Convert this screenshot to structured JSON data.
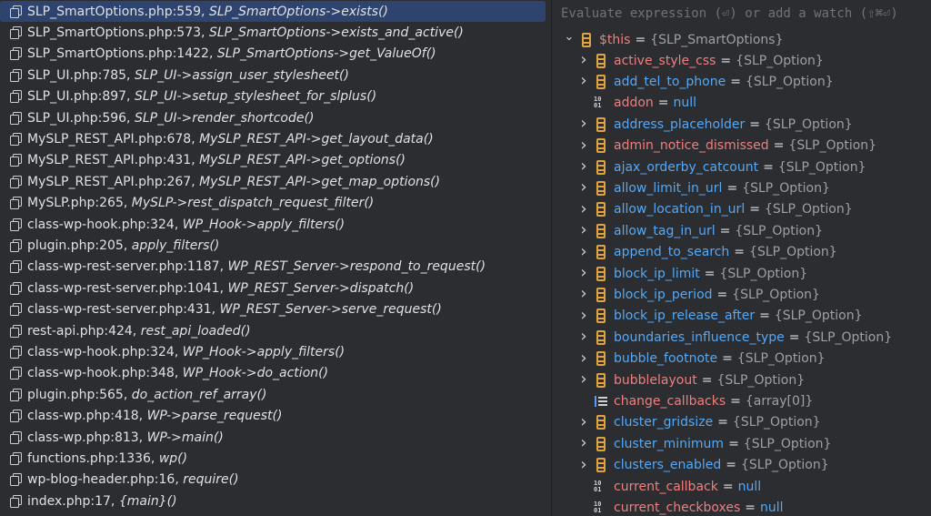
{
  "frames": [
    {
      "file": "SLP_SmartOptions.php:559,",
      "fn": "SLP_SmartOptions->exists()",
      "selected": true
    },
    {
      "file": "SLP_SmartOptions.php:573,",
      "fn": "SLP_SmartOptions->exists_and_active()"
    },
    {
      "file": "SLP_SmartOptions.php:1422,",
      "fn": "SLP_SmartOptions->get_ValueOf()"
    },
    {
      "file": "SLP_UI.php:785,",
      "fn": "SLP_UI->assign_user_stylesheet()"
    },
    {
      "file": "SLP_UI.php:897,",
      "fn": "SLP_UI->setup_stylesheet_for_slplus()"
    },
    {
      "file": "SLP_UI.php:596,",
      "fn": "SLP_UI->render_shortcode()"
    },
    {
      "file": "MySLP_REST_API.php:678,",
      "fn": "MySLP_REST_API->get_layout_data()"
    },
    {
      "file": "MySLP_REST_API.php:431,",
      "fn": "MySLP_REST_API->get_options()"
    },
    {
      "file": "MySLP_REST_API.php:267,",
      "fn": "MySLP_REST_API->get_map_options()"
    },
    {
      "file": "MySLP.php:265,",
      "fn": "MySLP->rest_dispatch_request_filter()"
    },
    {
      "file": "class-wp-hook.php:324,",
      "fn": "WP_Hook->apply_filters()"
    },
    {
      "file": "plugin.php:205,",
      "fn": "apply_filters()"
    },
    {
      "file": "class-wp-rest-server.php:1187,",
      "fn": "WP_REST_Server->respond_to_request()"
    },
    {
      "file": "class-wp-rest-server.php:1041,",
      "fn": "WP_REST_Server->dispatch()"
    },
    {
      "file": "class-wp-rest-server.php:431,",
      "fn": "WP_REST_Server->serve_request()"
    },
    {
      "file": "rest-api.php:424,",
      "fn": "rest_api_loaded()"
    },
    {
      "file": "class-wp-hook.php:324,",
      "fn": "WP_Hook->apply_filters()"
    },
    {
      "file": "class-wp-hook.php:348,",
      "fn": "WP_Hook->do_action()"
    },
    {
      "file": "plugin.php:565,",
      "fn": "do_action_ref_array()"
    },
    {
      "file": "class-wp.php:418,",
      "fn": "WP->parse_request()"
    },
    {
      "file": "class-wp.php:813,",
      "fn": "WP->main()"
    },
    {
      "file": "functions.php:1336,",
      "fn": "wp()"
    },
    {
      "file": "wp-blog-header.php:16,",
      "fn": "require()"
    },
    {
      "file": "index.php:17,",
      "fn": "{main}()"
    }
  ],
  "expression_bar": {
    "placeholder": "Evaluate expression (⏎) or add a watch (⇧⌘⏎)"
  },
  "variables": {
    "root": {
      "name": "$this",
      "value": "{SLP_SmartOptions}",
      "expanded": true,
      "icon": "object-icon"
    },
    "children": [
      {
        "name": "active_style_css",
        "value": "{SLP_Option}",
        "icon": "object-icon",
        "expandable": true,
        "color": "red"
      },
      {
        "name": "add_tel_to_phone",
        "value": "{SLP_Option}",
        "icon": "object-icon",
        "expandable": true,
        "color": "blue"
      },
      {
        "name": "addon",
        "value": "null",
        "icon": "primitive-icon",
        "expandable": false,
        "color": "red"
      },
      {
        "name": "address_placeholder",
        "value": "{SLP_Option}",
        "icon": "object-icon",
        "expandable": true,
        "color": "blue"
      },
      {
        "name": "admin_notice_dismissed",
        "value": "{SLP_Option}",
        "icon": "object-icon",
        "expandable": true,
        "color": "red"
      },
      {
        "name": "ajax_orderby_catcount",
        "value": "{SLP_Option}",
        "icon": "object-icon",
        "expandable": true,
        "color": "blue"
      },
      {
        "name": "allow_limit_in_url",
        "value": "{SLP_Option}",
        "icon": "object-icon",
        "expandable": true,
        "color": "blue"
      },
      {
        "name": "allow_location_in_url",
        "value": "{SLP_Option}",
        "icon": "object-icon",
        "expandable": true,
        "color": "blue"
      },
      {
        "name": "allow_tag_in_url",
        "value": "{SLP_Option}",
        "icon": "object-icon",
        "expandable": true,
        "color": "blue"
      },
      {
        "name": "append_to_search",
        "value": "{SLP_Option}",
        "icon": "object-icon",
        "expandable": true,
        "color": "blue"
      },
      {
        "name": "block_ip_limit",
        "value": "{SLP_Option}",
        "icon": "object-icon",
        "expandable": true,
        "color": "blue"
      },
      {
        "name": "block_ip_period",
        "value": "{SLP_Option}",
        "icon": "object-icon",
        "expandable": true,
        "color": "blue"
      },
      {
        "name": "block_ip_release_after",
        "value": "{SLP_Option}",
        "icon": "object-icon",
        "expandable": true,
        "color": "blue"
      },
      {
        "name": "boundaries_influence_type",
        "value": "{SLP_Option}",
        "icon": "object-icon",
        "expandable": true,
        "color": "blue"
      },
      {
        "name": "bubble_footnote",
        "value": "{SLP_Option}",
        "icon": "object-icon",
        "expandable": true,
        "color": "blue"
      },
      {
        "name": "bubblelayout",
        "value": "{SLP_Option}",
        "icon": "object-icon",
        "expandable": true,
        "color": "red"
      },
      {
        "name": "change_callbacks",
        "value": "{array[0]}",
        "icon": "array-icon",
        "expandable": false,
        "color": "red"
      },
      {
        "name": "cluster_gridsize",
        "value": "{SLP_Option}",
        "icon": "object-icon",
        "expandable": true,
        "color": "blue"
      },
      {
        "name": "cluster_minimum",
        "value": "{SLP_Option}",
        "icon": "object-icon",
        "expandable": true,
        "color": "blue"
      },
      {
        "name": "clusters_enabled",
        "value": "{SLP_Option}",
        "icon": "object-icon",
        "expandable": true,
        "color": "blue"
      },
      {
        "name": "current_callback",
        "value": "null",
        "icon": "primitive-icon",
        "expandable": false,
        "color": "red"
      },
      {
        "name": "current_checkboxes",
        "value": "null",
        "icon": "primitive-icon",
        "expandable": false,
        "color": "red"
      }
    ]
  },
  "colors": {
    "background": "#2b2d30",
    "selection": "#2e436e",
    "name_red": "#ef7f7f",
    "name_blue": "#56a8f5",
    "object_icon": "#e0a33e"
  }
}
